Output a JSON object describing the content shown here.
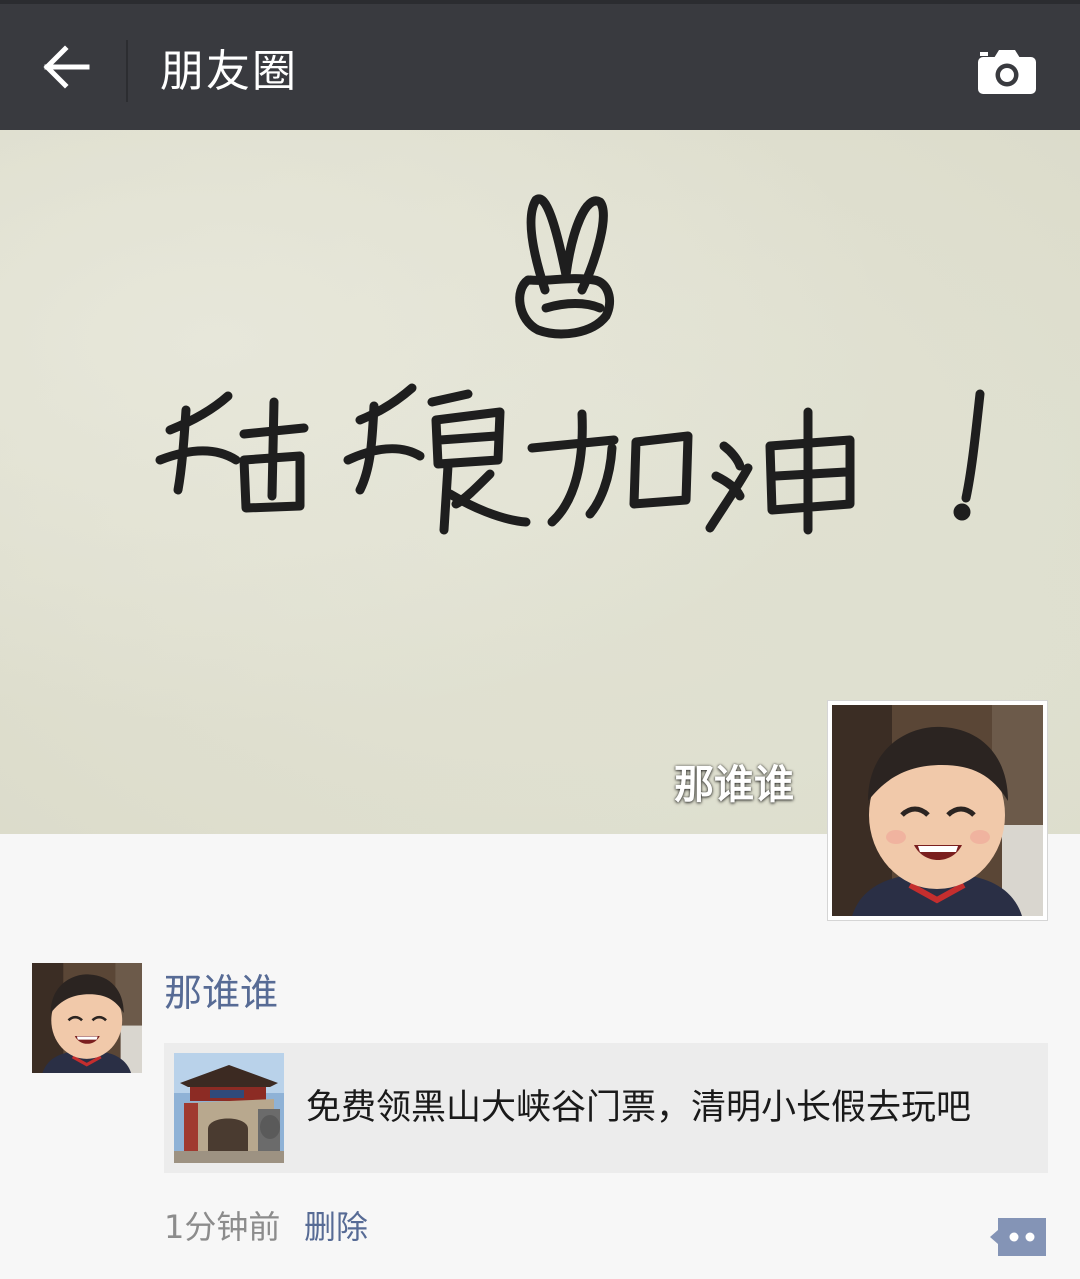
{
  "header": {
    "back_icon": "arrow-left-icon",
    "title": "朋友圈",
    "camera_icon": "camera-icon"
  },
  "colors": {
    "topbar": "#393a3f",
    "link_blue": "#576b95",
    "page_bg": "#f7f7f7",
    "card_bg": "#ececec"
  },
  "cover": {
    "handwritten_text": "姑娘加油!",
    "user_name": "那谁谁",
    "avatar_icon": "child-avatar"
  },
  "post": {
    "author": "那谁谁",
    "avatar_icon": "child-avatar",
    "link": {
      "thumbnail_icon": "temple-gate-thumbnail",
      "title": "免费领黑山大峡谷门票，清明小长假去玩吧"
    },
    "time": "1分钟前",
    "delete_label": "删除",
    "comment_icon": "comment-icon"
  }
}
